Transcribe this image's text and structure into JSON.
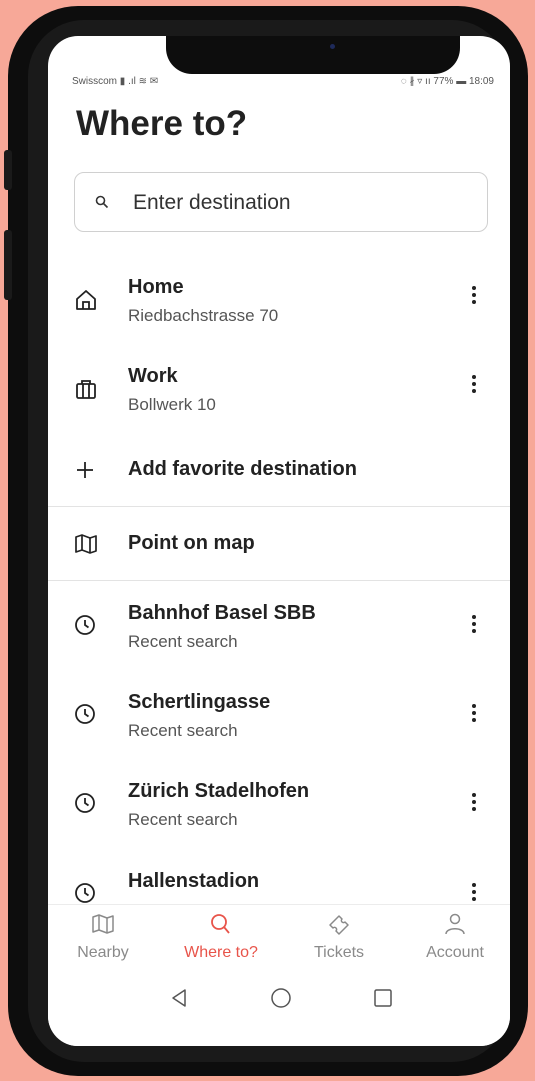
{
  "status_bar": {
    "carrier": "Swisscom",
    "right": "77%",
    "time": "18:09"
  },
  "page": {
    "title": "Where to?"
  },
  "search": {
    "placeholder": "Enter destination"
  },
  "favorites": [
    {
      "icon": "home-icon",
      "title": "Home",
      "subtitle": "Riedbachstrasse 70"
    },
    {
      "icon": "briefcase-icon",
      "title": "Work",
      "subtitle": "Bollwerk 10"
    }
  ],
  "add_favorite_label": "Add favorite destination",
  "point_on_map_label": "Point on map",
  "recent": [
    {
      "title": "Bahnhof Basel SBB",
      "subtitle": "Recent search"
    },
    {
      "title": "Schertlingasse",
      "subtitle": "Recent search"
    },
    {
      "title": "Zürich Stadelhofen",
      "subtitle": "Recent search"
    },
    {
      "title": "Hallenstadion",
      "subtitle": ""
    }
  ],
  "bottom_nav": [
    {
      "label": "Nearby",
      "icon": "map-icon",
      "active": false
    },
    {
      "label": "Where to?",
      "icon": "search-icon",
      "active": true
    },
    {
      "label": "Tickets",
      "icon": "ticket-icon",
      "active": false
    },
    {
      "label": "Account",
      "icon": "person-icon",
      "active": false
    }
  ],
  "colors": {
    "accent": "#e8544a",
    "background": "#f7a898"
  }
}
